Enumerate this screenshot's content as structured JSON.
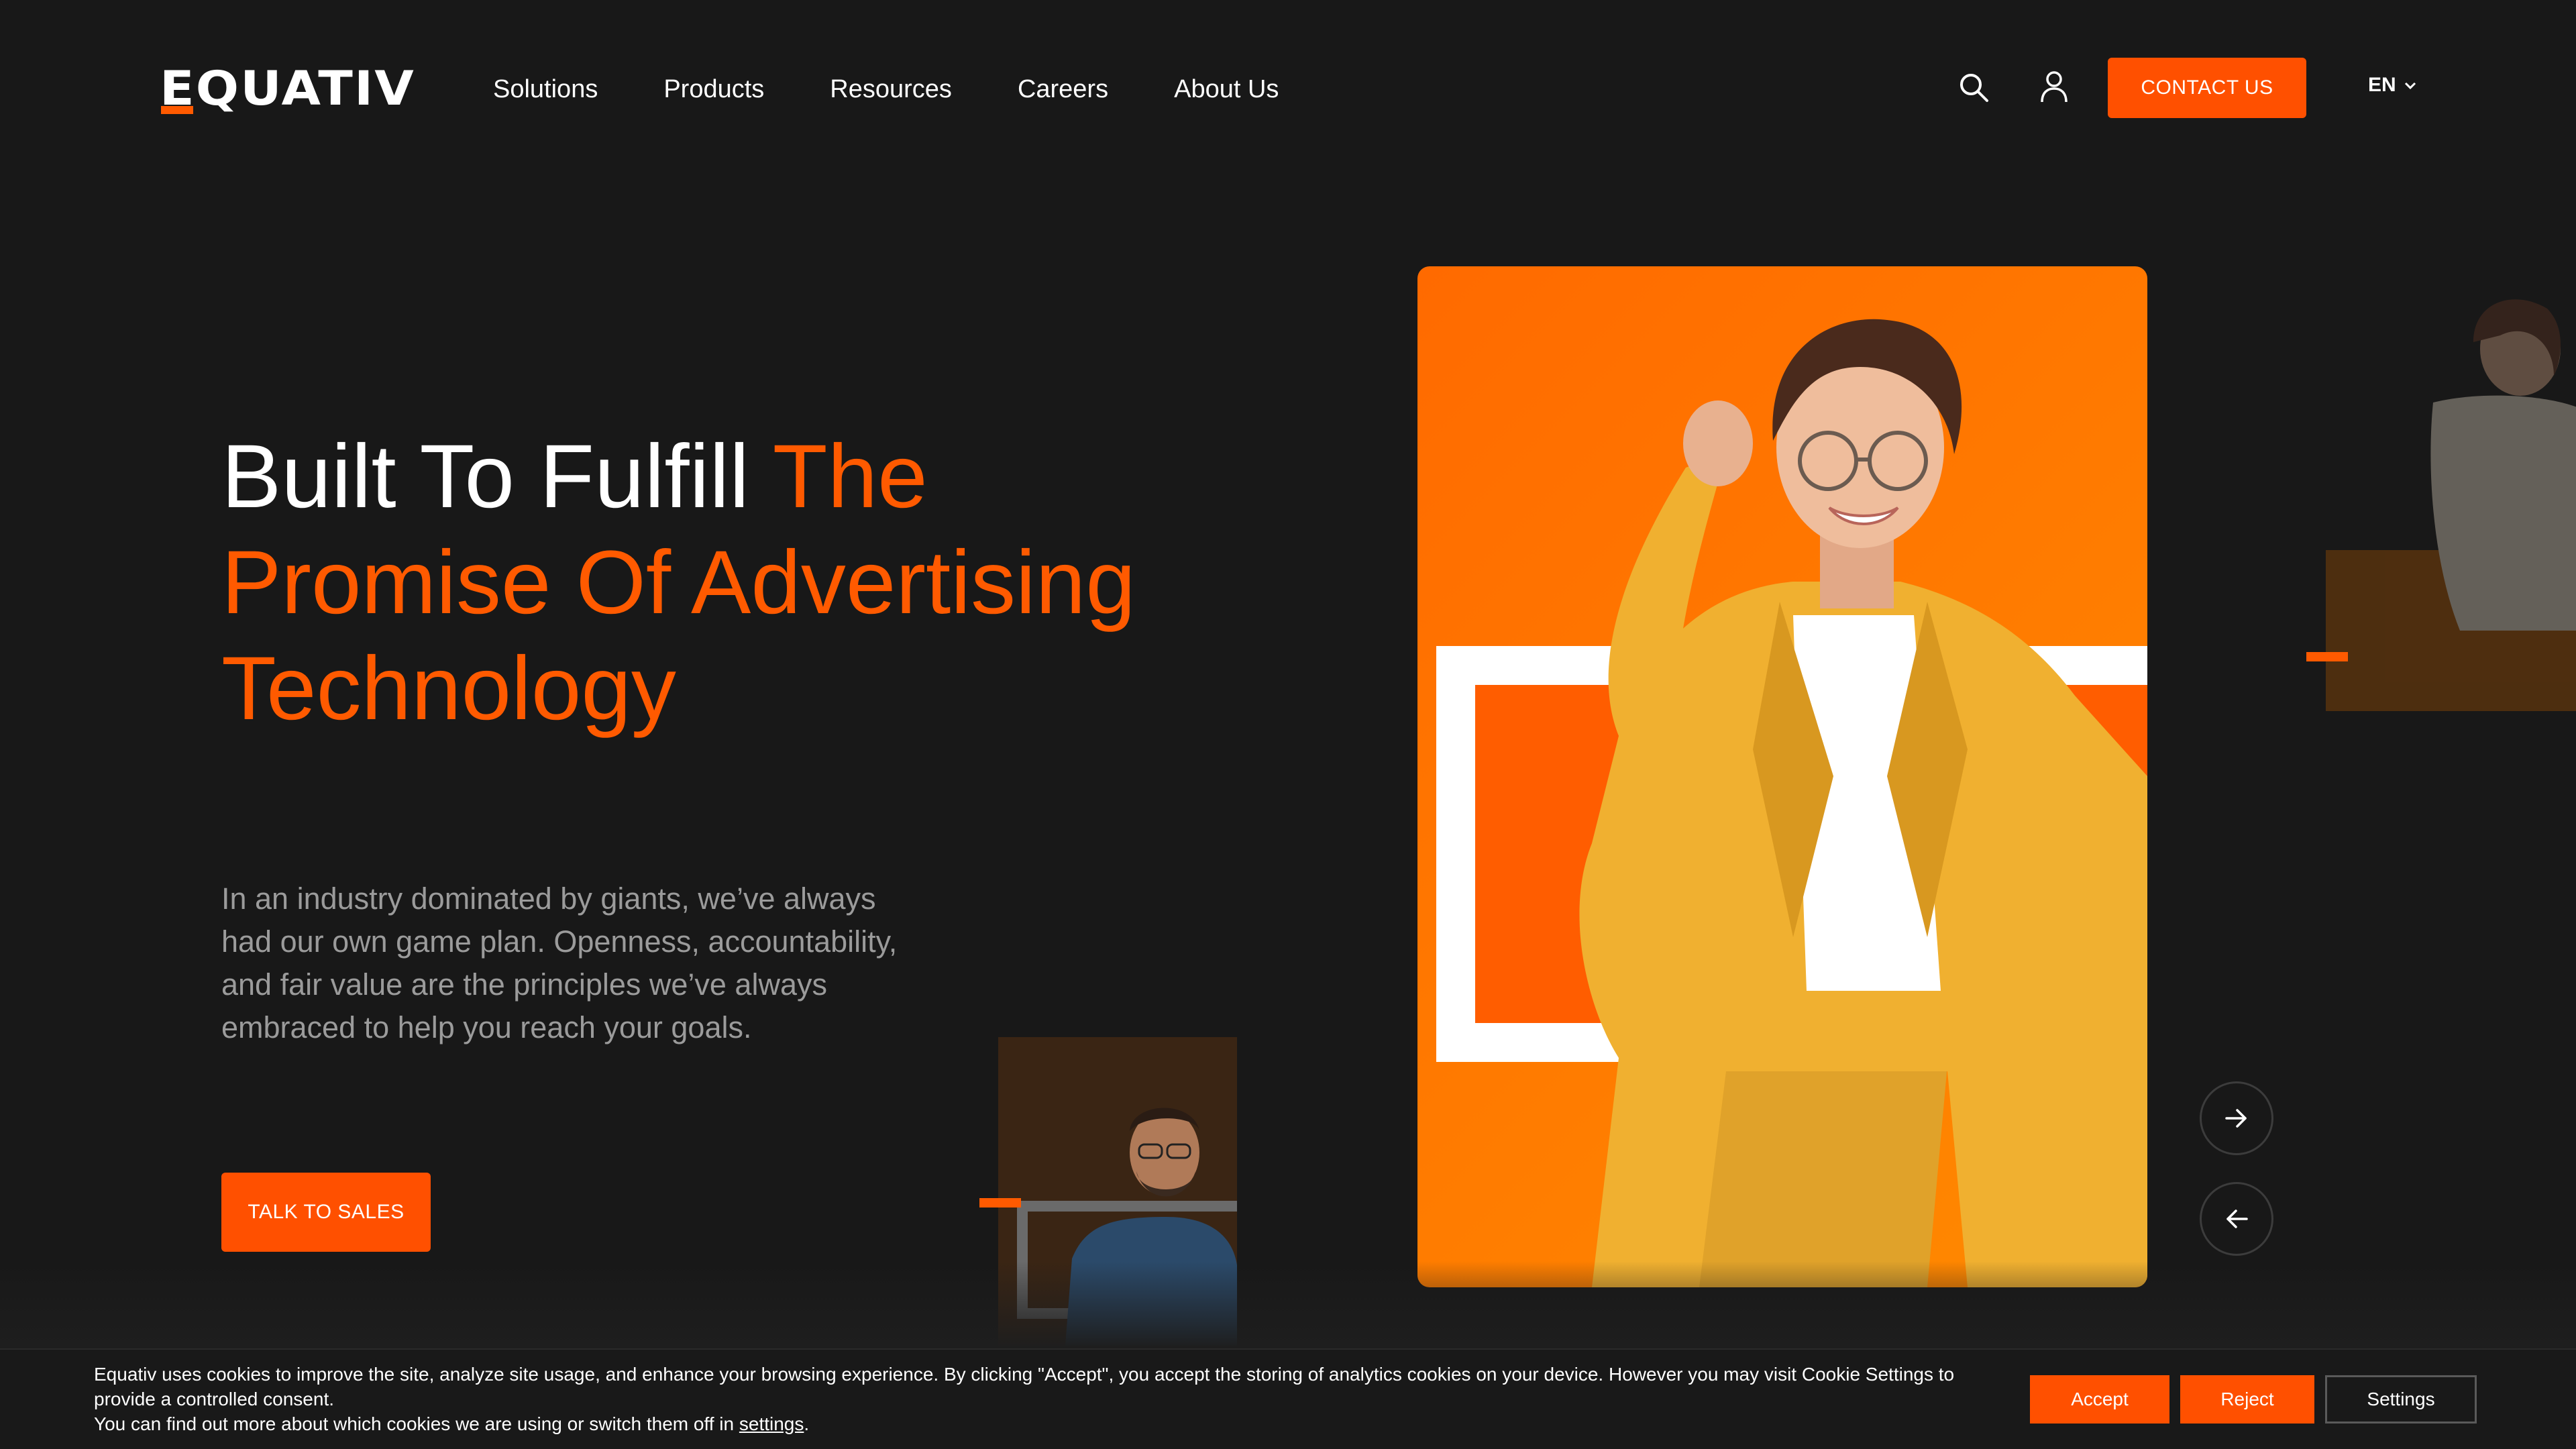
{
  "brand": {
    "logo_text": "EQUATIV",
    "accent_color": "#ff5a00",
    "background_color": "#181818"
  },
  "nav": {
    "items": [
      {
        "label": "Solutions"
      },
      {
        "label": "Products"
      },
      {
        "label": "Resources"
      },
      {
        "label": "Careers"
      },
      {
        "label": "About Us"
      }
    ]
  },
  "header": {
    "search_icon": "search-icon",
    "account_icon": "user-icon",
    "contact_label": "CONTACT US",
    "language": "EN"
  },
  "hero": {
    "title_white": "Built To Fulfill",
    "title_accent_1": "The",
    "title_accent_2": "Promise Of Advertising",
    "title_accent_3": "Technology",
    "description": "In an industry dominated by giants, we’ve always had our own game plan. Openness, accountability, and fair value are the principles we’ve always embraced to help you reach your goals.",
    "cta_label": "TALK TO SALES"
  },
  "carousel": {
    "next_icon": "arrow-right-icon",
    "prev_icon": "arrow-left-icon"
  },
  "cookie_banner": {
    "line1": "Equativ uses cookies to improve the site, analyze site usage, and enhance your browsing experience. By clicking \"Accept\", you accept the storing of analytics cookies on your device. However you may visit Cookie Settings to provide a controlled consent.",
    "line2_prefix": "You can find out more about which cookies we are using or switch them off in ",
    "line2_link": "settings",
    "line2_suffix": ".",
    "accept_label": "Accept",
    "reject_label": "Reject",
    "settings_label": "Settings"
  }
}
